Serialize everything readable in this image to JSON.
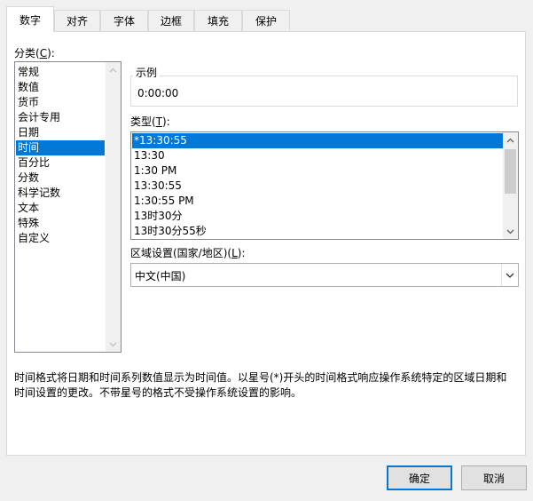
{
  "tabs": [
    "数字",
    "对齐",
    "字体",
    "边框",
    "填充",
    "保护"
  ],
  "category": {
    "label_prefix": "分类(",
    "label_key": "C",
    "label_suffix": "):",
    "items": [
      "常规",
      "数值",
      "货币",
      "会计专用",
      "日期",
      "时间",
      "百分比",
      "分数",
      "科学记数",
      "文本",
      "特殊",
      "自定义"
    ],
    "selected": "时间"
  },
  "sample": {
    "label": "示例",
    "value": "0:00:00"
  },
  "type": {
    "label_prefix": "类型(",
    "label_key": "T",
    "label_suffix": "):",
    "items": [
      "*13:30:55",
      "13:30",
      "1:30 PM",
      "13:30:55",
      "1:30:55 PM",
      "13时30分",
      "13时30分55秒"
    ],
    "selected": "*13:30:55"
  },
  "locale": {
    "label_prefix": "区域设置(国家/地区)(",
    "label_key": "L",
    "label_suffix": "):",
    "value": "中文(中国)"
  },
  "description": "时间格式将日期和时间系列数值显示为时间值。以星号(*)开头的时间格式响应操作系统特定的区域日期和时间设置的更改。不带星号的格式不受操作系统设置的影响。",
  "buttons": {
    "ok": "确定",
    "cancel": "取消"
  },
  "colors": {
    "selection": "#0078d7",
    "accent_border": "#0078d7"
  }
}
